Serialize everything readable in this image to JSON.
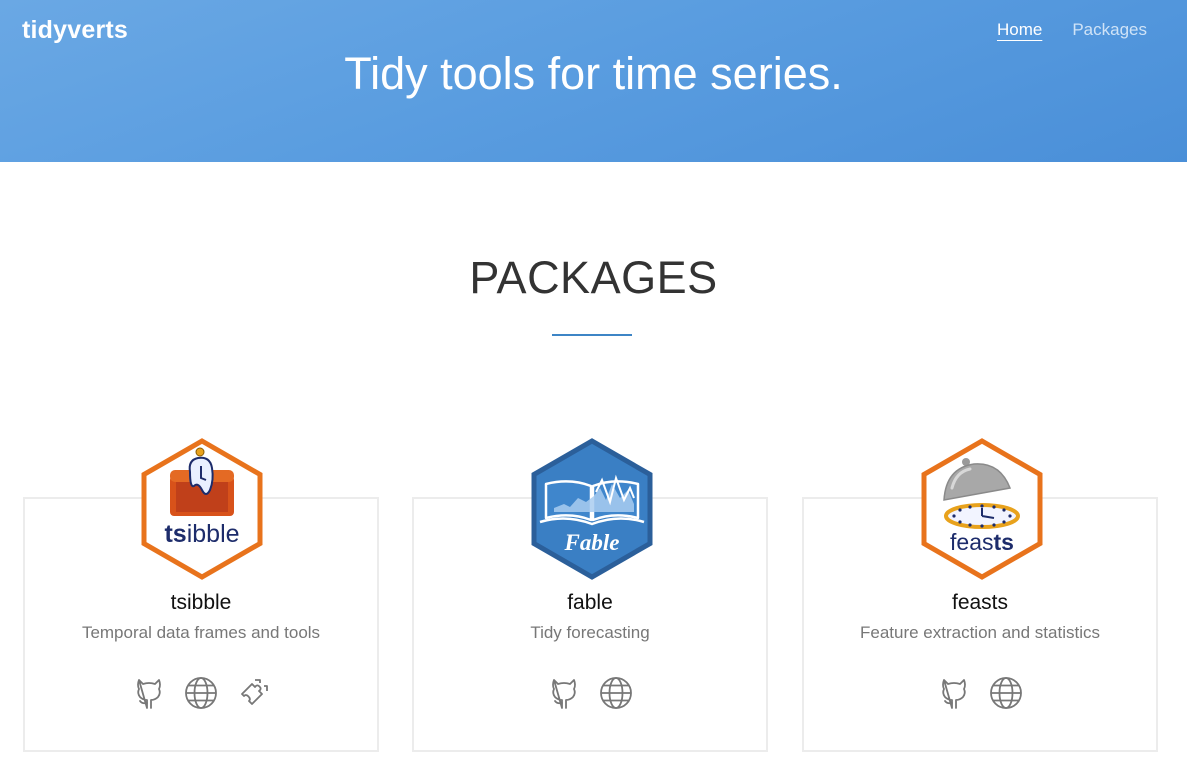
{
  "header": {
    "brand": "tidyverts",
    "nav": [
      {
        "label": "Home",
        "active": true
      },
      {
        "label": "Packages",
        "active": false
      }
    ],
    "tagline": "Tidy tools for time series."
  },
  "section": {
    "title": "PACKAGES",
    "accent_color": "#3d85c6"
  },
  "packages": [
    {
      "name": "tsibble",
      "description": "Temporal data frames and tools",
      "logo_text_bold": "ts",
      "logo_text_rest": "ibble",
      "links": [
        "github-icon",
        "globe-icon",
        "puzzle-icon"
      ]
    },
    {
      "name": "fable",
      "description": "Tidy forecasting",
      "logo_text": "Fable",
      "links": [
        "github-icon",
        "globe-icon"
      ]
    },
    {
      "name": "feasts",
      "description": "Feature extraction and statistics",
      "logo_text_rest": "feas",
      "logo_text_bold": "ts",
      "links": [
        "github-icon",
        "globe-icon"
      ]
    }
  ],
  "colors": {
    "hero": "#5a9de0",
    "hex_orange": "#e8731c",
    "hex_blue": "#3a7fc4",
    "logo_navy": "#1d2c6b"
  }
}
